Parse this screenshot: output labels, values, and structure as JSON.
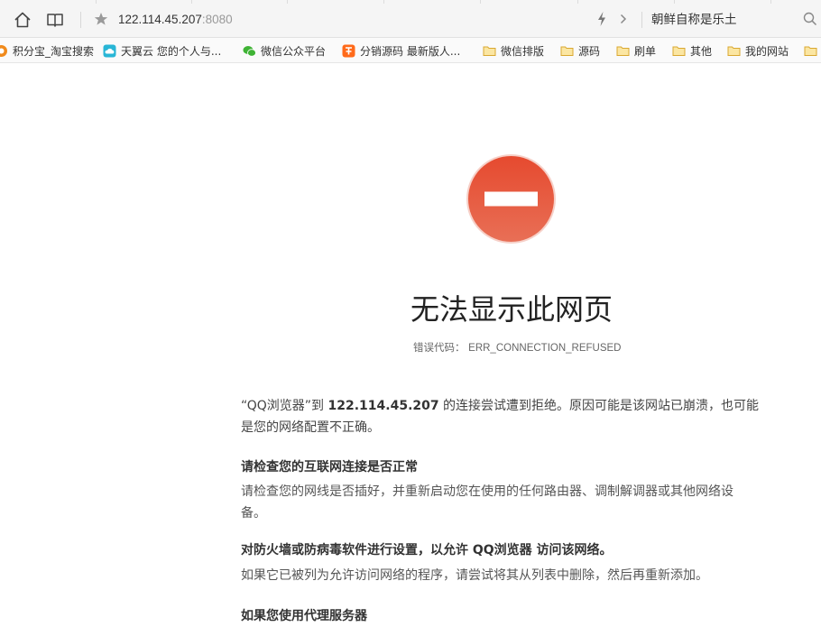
{
  "toolbar": {
    "url_host": "122.114.45.207",
    "url_port": ":8080",
    "search_text": "朝鲜自称是乐土"
  },
  "bookmarks": [
    {
      "label": "积分宝_淘宝搜索",
      "icon": "orange-logo-icon"
    },
    {
      "label": "天翼云 您的个人与...",
      "icon": "cloud-icon"
    },
    {
      "label": "微信公众平台",
      "icon": "wechat-icon"
    },
    {
      "label": "分销源码 最新版人...",
      "icon": "taobao-icon"
    },
    {
      "label": "微信排版",
      "icon": "folder-icon"
    },
    {
      "label": "源码",
      "icon": "folder-icon"
    },
    {
      "label": "刷单",
      "icon": "folder-icon"
    },
    {
      "label": "其他",
      "icon": "folder-icon"
    },
    {
      "label": "我的网站",
      "icon": "folder-icon"
    }
  ],
  "error": {
    "title": "无法显示此网页",
    "code_label": "错误代码：",
    "code": "ERR_CONNECTION_REFUSED",
    "desc_prefix": "“QQ浏览器”到 ",
    "desc_host": "122.114.45.207",
    "desc_line1_rest": " 的连接尝试遭到拒绝。原因可能是该网站已崩溃，也可能",
    "desc_line2": "是您的网络配置不正确。",
    "tips": [
      {
        "heading": "请检查您的互联网连接是否正常",
        "body1": "请检查您的网线是否插好，并重新启动您在使用的任何路由器、调制解调器或其他网络设",
        "body2": "备。"
      },
      {
        "heading": "对防火墙或防病毒软件进行设置，以允许 QQ浏览器 访问该网络。",
        "body1": "如果它已被列为允许访问网络的程序，请尝试将其从列表中删除，然后再重新添加。",
        "body2": ""
      },
      {
        "heading": "如果您使用代理服务器",
        "body1": "",
        "body2": ""
      }
    ]
  },
  "colors": {
    "error_red": "#e0452e",
    "folder_yellow": "#f3c54a"
  }
}
